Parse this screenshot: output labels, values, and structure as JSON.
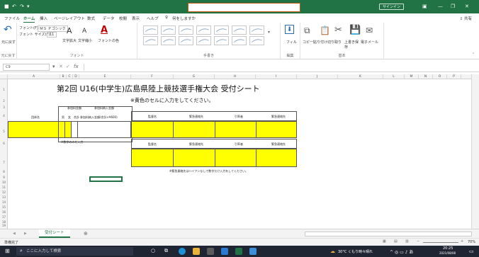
{
  "colors": {
    "accent": "#217346",
    "yellow": "#ffff00"
  },
  "window": {
    "sign_in": "サインイン"
  },
  "menu": [
    {
      "label": "ファイル"
    },
    {
      "label": "ホーム",
      "active": true
    },
    {
      "label": "挿入"
    },
    {
      "label": "ページレイアウト"
    },
    {
      "label": "数式"
    },
    {
      "label": "データ"
    },
    {
      "label": "校閲"
    },
    {
      "label": "表示"
    },
    {
      "label": "ヘルプ"
    },
    {
      "label": "何をしますか"
    }
  ],
  "share_label": "共有",
  "ribbon": {
    "undo_label": "元に戻す",
    "font_name": "ＭＳ Ｐゴシック",
    "font_size": "11",
    "font_line1": "フォント(F):",
    "font_line2": "フォント サイズ(F):",
    "font_grow": "文字拡大",
    "font_shrink": "文字縮小",
    "font_color": "フォントの色",
    "fill_label": "フィル",
    "copy": "コピー",
    "paste_all": "貼り付け",
    "cut": "切り取り",
    "save_over": "上書き保存",
    "email": "電子メール",
    "groups": {
      "undo": "元に戻す",
      "font": "フォント",
      "styles": "手書き",
      "edit": "編集",
      "basic": "基本"
    }
  },
  "formula": {
    "name_box": "C9",
    "fx": "fx"
  },
  "columns": [
    "A",
    "B",
    "C",
    "D",
    "E",
    "F",
    "G",
    "H",
    "I",
    "J",
    "K",
    "L",
    "M",
    "N",
    "O",
    "P"
  ],
  "rows": [
    "1",
    "2",
    "3",
    "4",
    "5",
    "6",
    "7",
    "8",
    "9",
    "10",
    "11",
    "12",
    "13",
    "14",
    "15",
    "16",
    "17",
    "18",
    "19",
    "20",
    "21"
  ],
  "sheet": {
    "title": "第2回 U16(中学生)広島県陸上競技選手権大会  受付シート",
    "note": "※黄色のセルに入力をしてください。",
    "headers": {
      "team": "団体名",
      "count_group": "参加料金額",
      "male": "男",
      "female": "女",
      "total": "合計",
      "fee_group": "参加料納入金額",
      "fee": "参加料納入金額(合計×¥600)",
      "supervisor": "監督名",
      "contact": "緊急連絡先",
      "head": "引率者",
      "contact2": "緊急連絡先"
    },
    "num_note": "※数字のみを入力",
    "phone_note": "※緊急連絡先はハイフンなしで数字だけ入力をしてください。"
  },
  "tabs": {
    "sheet1": "受付シート",
    "add": "⊕"
  },
  "status": {
    "ready": "準備完了",
    "zoom": "70%"
  },
  "taskbar": {
    "search": "ここに入力して検索",
    "weather": "30°C くもり時々晴れ",
    "time": "20:25",
    "date": "2021/08/08"
  }
}
